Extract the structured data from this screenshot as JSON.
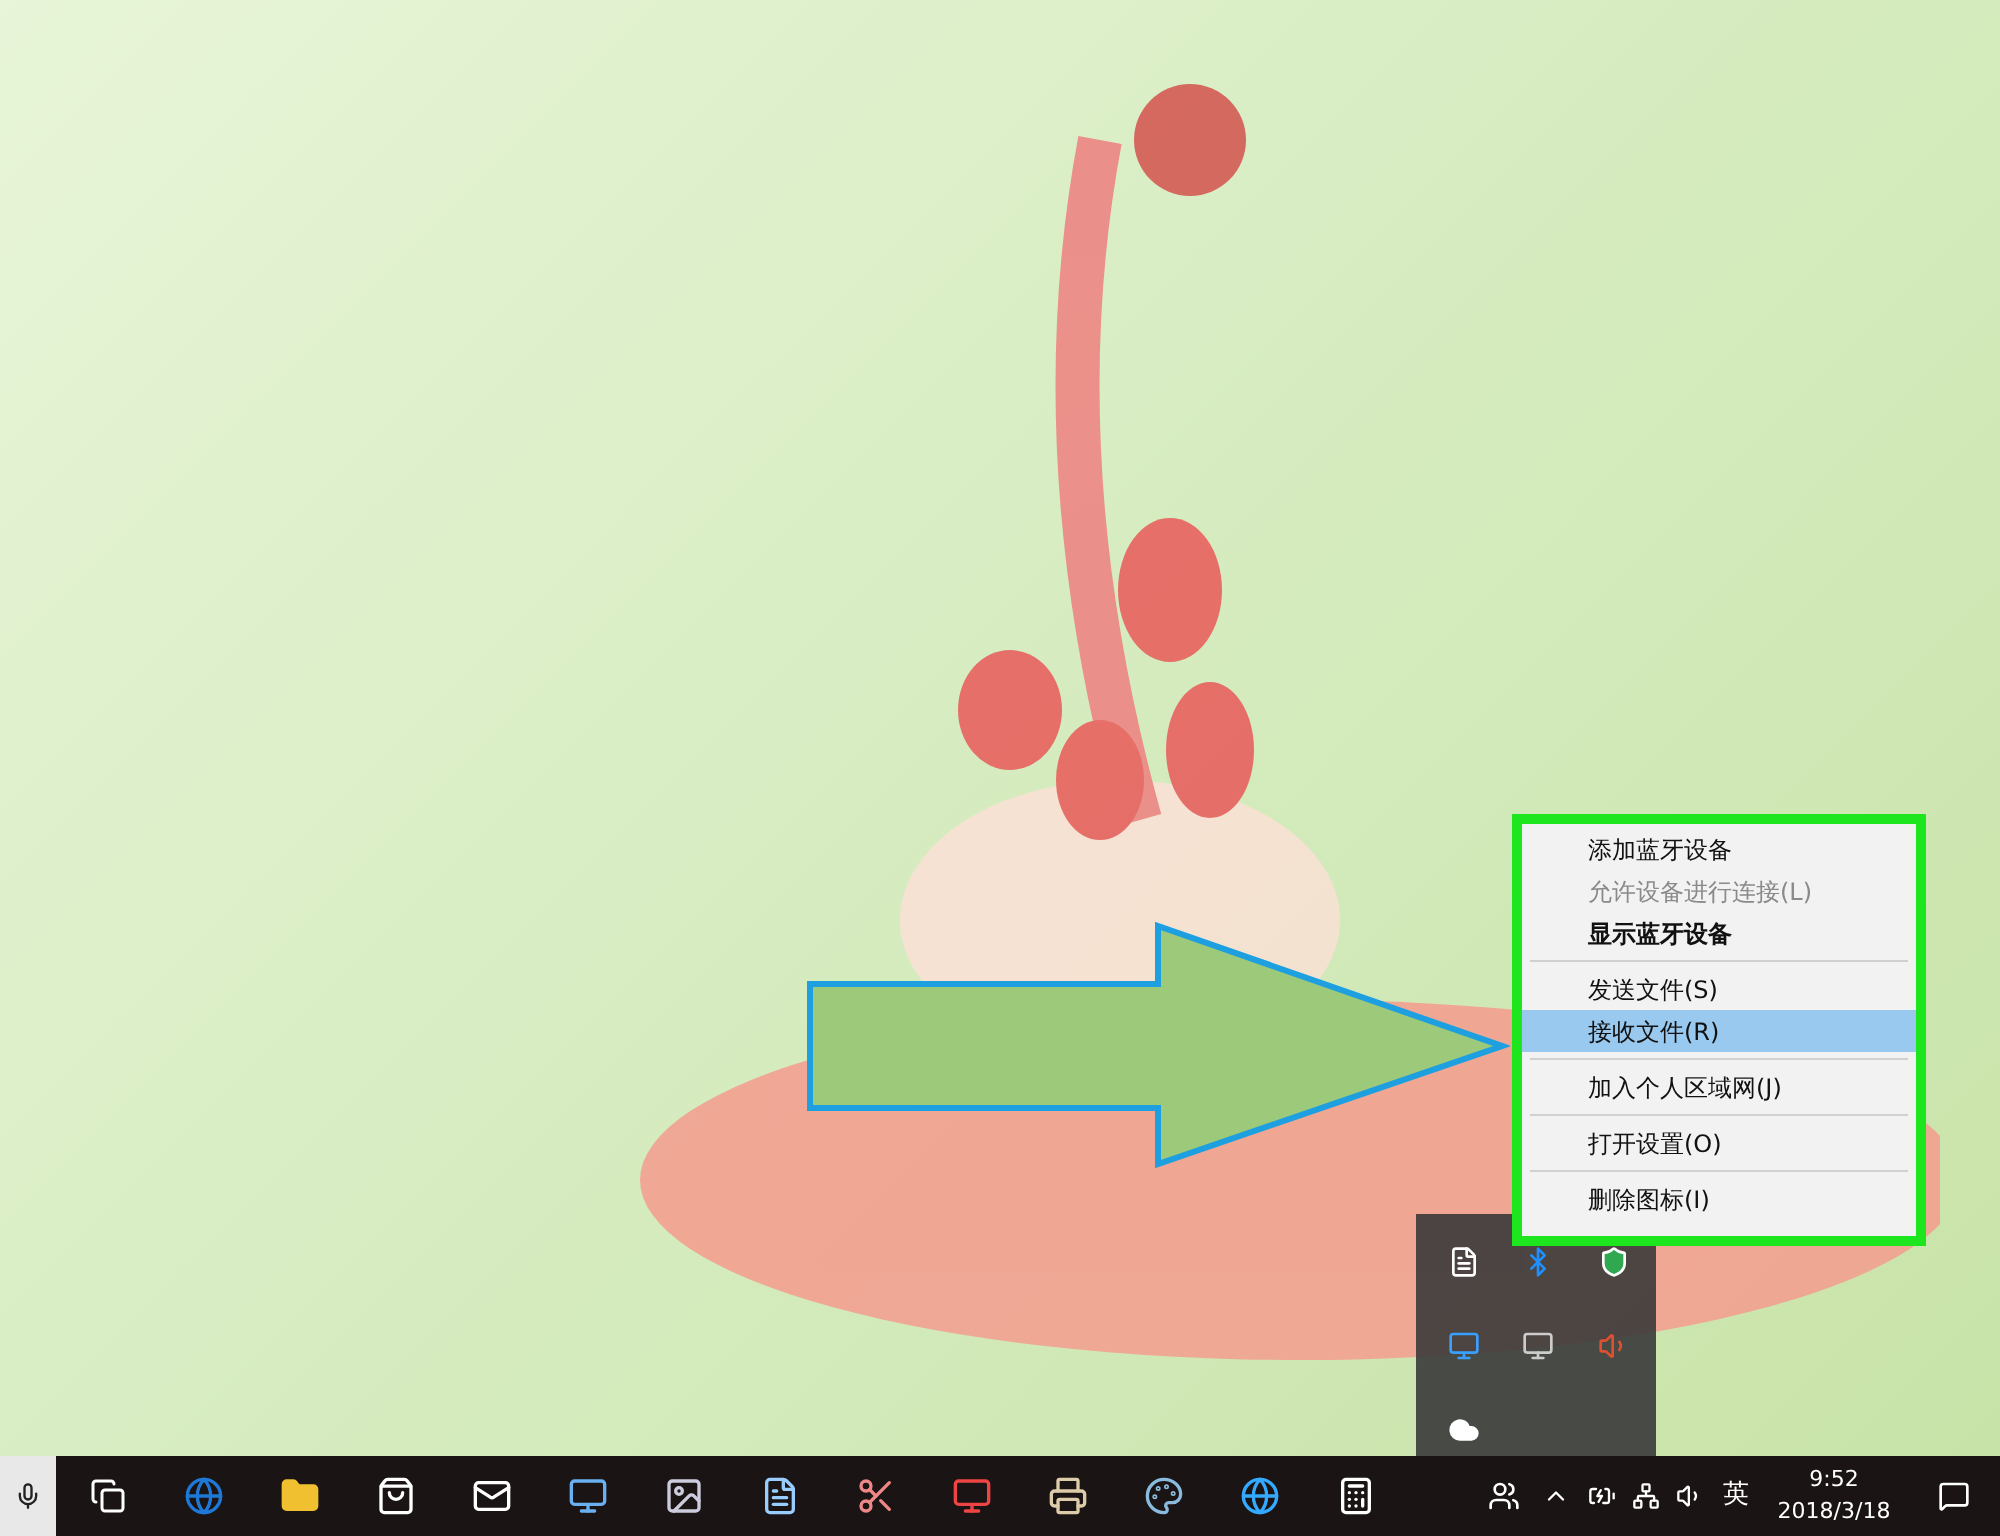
{
  "context_menu": {
    "items": [
      {
        "kind": "item",
        "label": "添加蓝牙设备",
        "disabled": false,
        "default": false,
        "selected": false
      },
      {
        "kind": "item",
        "label": "允许设备进行连接(L)",
        "disabled": true,
        "default": false,
        "selected": false
      },
      {
        "kind": "item",
        "label": "显示蓝牙设备",
        "disabled": false,
        "default": true,
        "selected": false
      },
      {
        "kind": "separator"
      },
      {
        "kind": "item",
        "label": "发送文件(S)",
        "disabled": false,
        "default": false,
        "selected": false
      },
      {
        "kind": "item",
        "label": "接收文件(R)",
        "disabled": false,
        "default": false,
        "selected": true
      },
      {
        "kind": "separator"
      },
      {
        "kind": "item",
        "label": "加入个人区域网(J)",
        "disabled": false,
        "default": false,
        "selected": false
      },
      {
        "kind": "separator"
      },
      {
        "kind": "item",
        "label": "打开设置(O)",
        "disabled": false,
        "default": false,
        "selected": false
      },
      {
        "kind": "separator"
      },
      {
        "kind": "item",
        "label": "删除图标(I)",
        "disabled": false,
        "default": false,
        "selected": false
      }
    ]
  },
  "taskbar": {
    "ime": "英",
    "time": "9:52",
    "date": "2018/3/18"
  }
}
